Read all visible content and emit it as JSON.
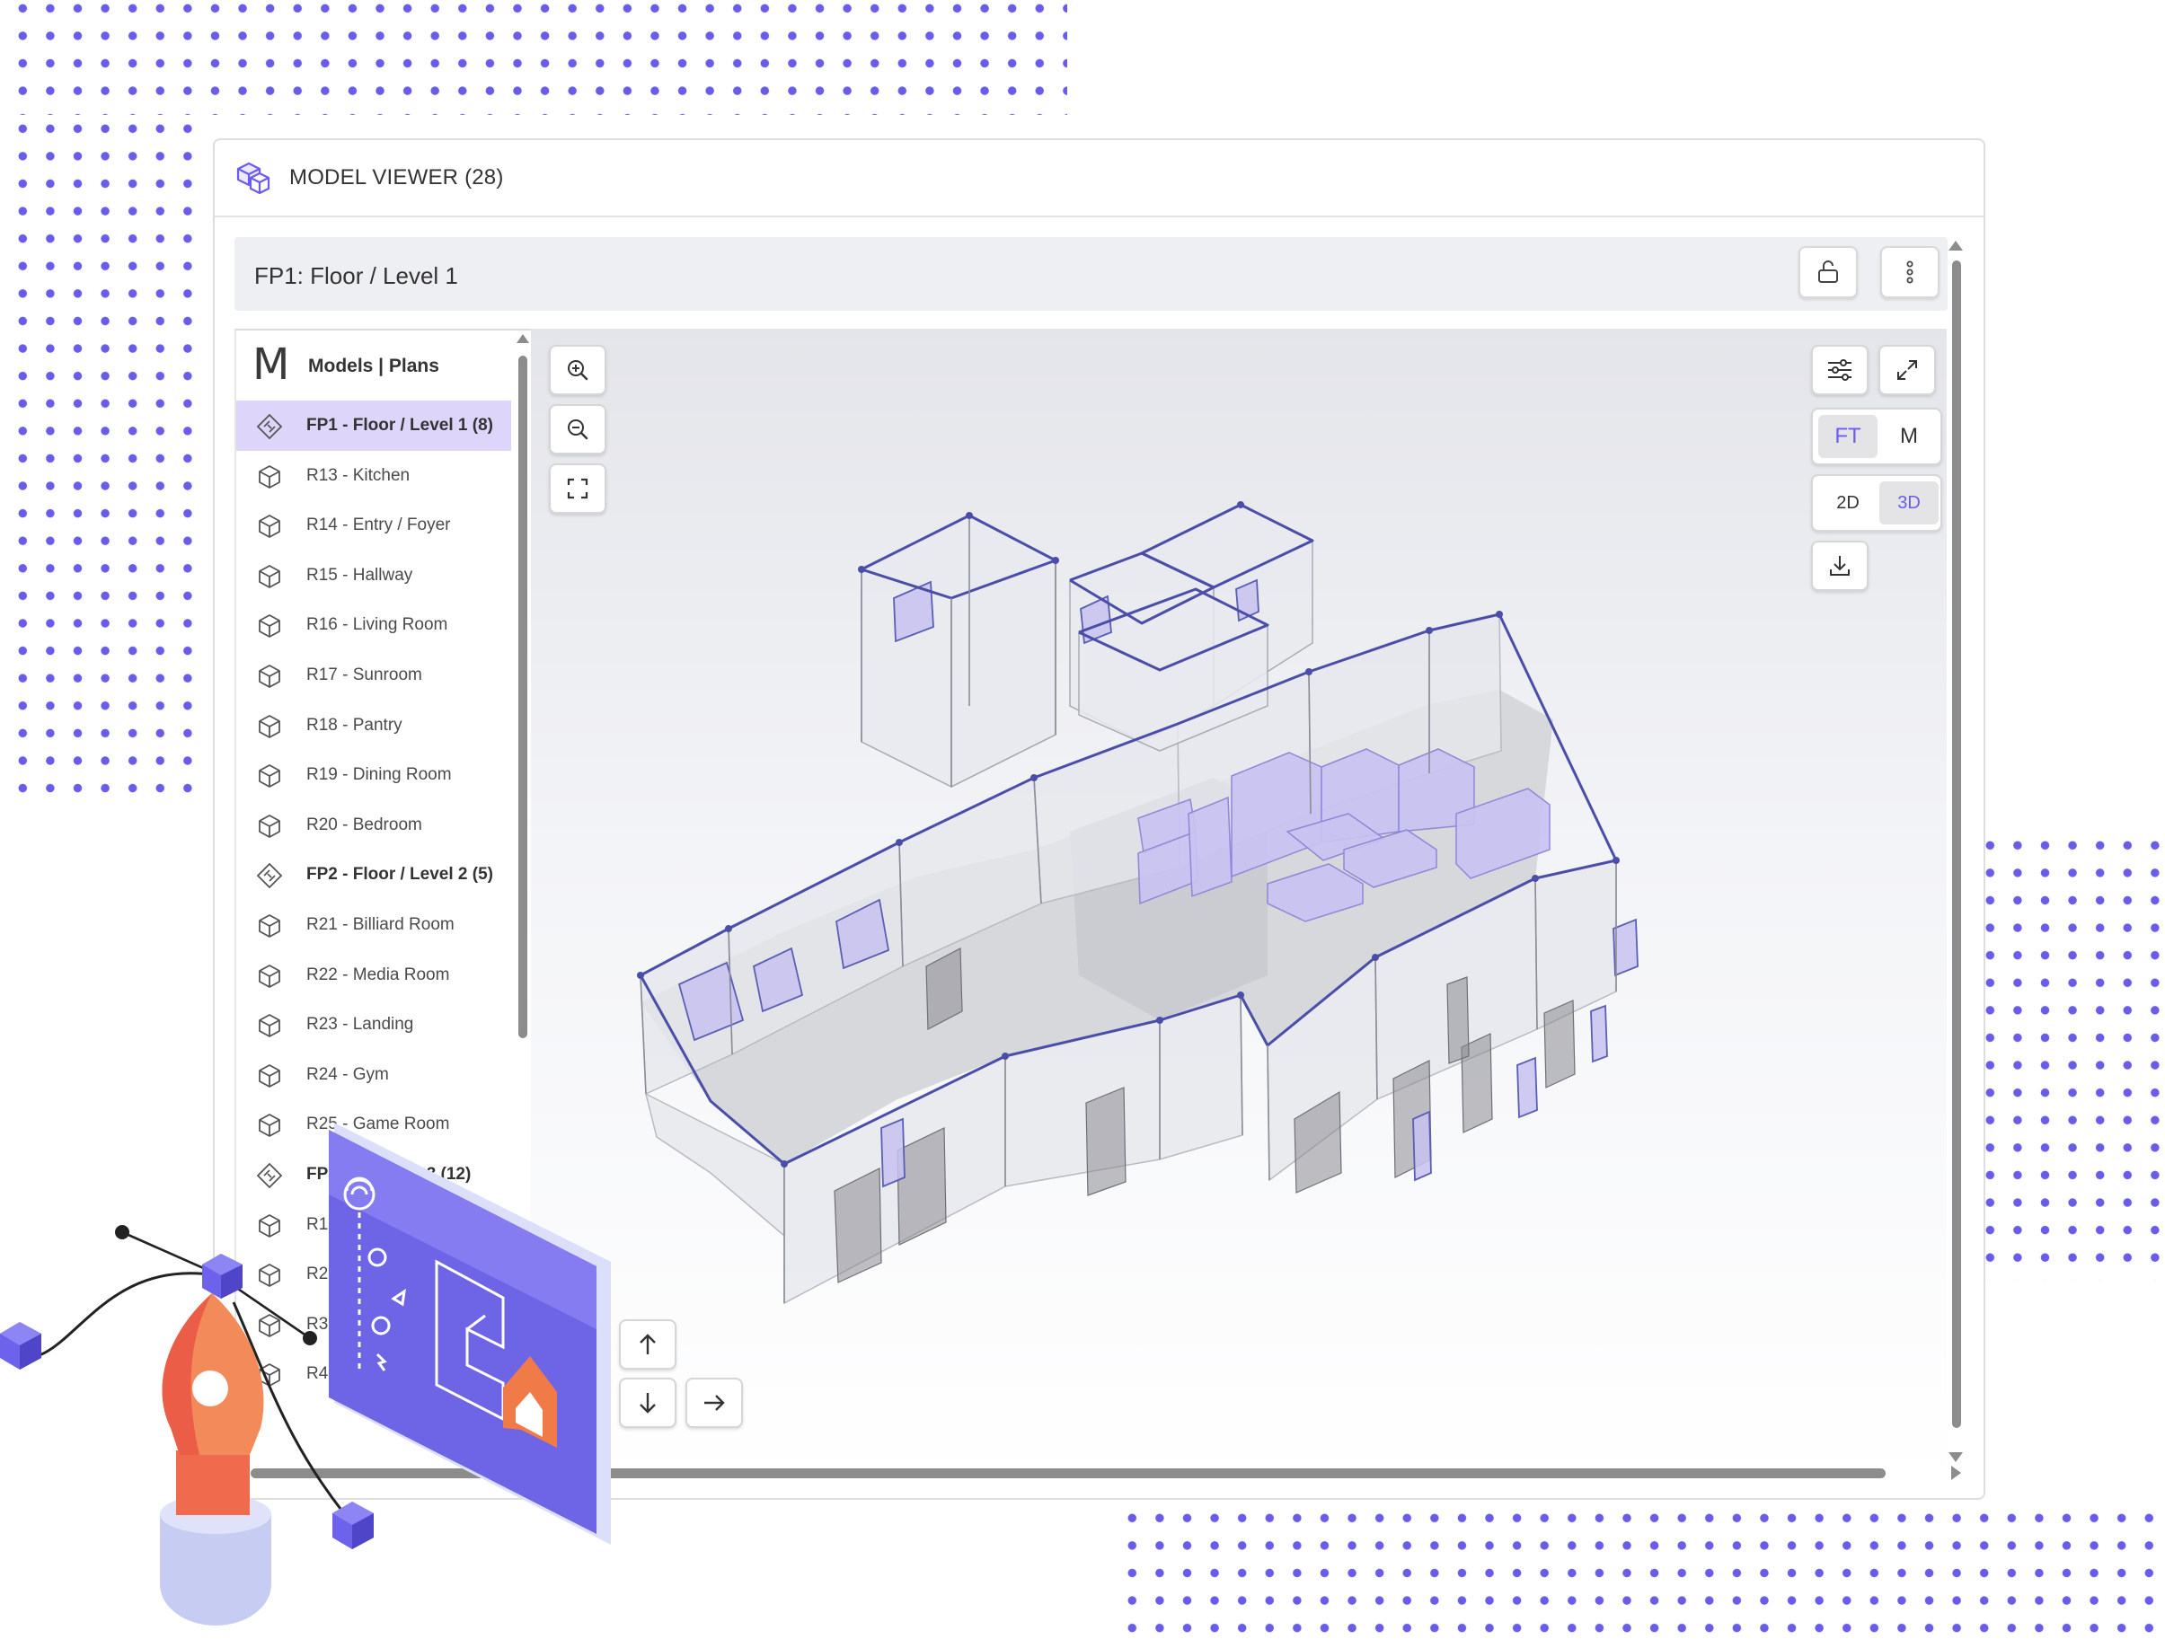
{
  "window": {
    "title": "MODEL VIEWER (28)"
  },
  "plan_bar": {
    "title": "FP1: Floor / Level 1"
  },
  "sidebar": {
    "logo": "M",
    "title": "Models | Plans",
    "items": [
      {
        "label": "FP1 - Floor / Level 1 (8)",
        "kind": "floor",
        "active": true
      },
      {
        "label": "R13 - Kitchen",
        "kind": "room"
      },
      {
        "label": "R14 - Entry / Foyer",
        "kind": "room"
      },
      {
        "label": "R15 - Hallway",
        "kind": "room"
      },
      {
        "label": "R16 - Living Room",
        "kind": "room"
      },
      {
        "label": "R17 - Sunroom",
        "kind": "room"
      },
      {
        "label": "R18 - Pantry",
        "kind": "room"
      },
      {
        "label": "R19 - Dining Room",
        "kind": "room"
      },
      {
        "label": "R20 - Bedroom",
        "kind": "room"
      },
      {
        "label": "FP2 - Floor / Level 2 (5)",
        "kind": "floor"
      },
      {
        "label": "R21 - Billiard Room",
        "kind": "room"
      },
      {
        "label": "R22 - Media Room",
        "kind": "room"
      },
      {
        "label": "R23 - Landing",
        "kind": "room"
      },
      {
        "label": "R24 - Gym",
        "kind": "room"
      },
      {
        "label": "R25 - Game Room",
        "kind": "room"
      },
      {
        "label": "FP3",
        "label_tail": "vel 3 (12)",
        "kind": "floor"
      },
      {
        "label": "R1",
        "kind": "room"
      },
      {
        "label": "R2",
        "kind": "room"
      },
      {
        "label": "R3",
        "kind": "room"
      },
      {
        "label": "R4",
        "kind": "room"
      }
    ]
  },
  "viewer": {
    "units": {
      "ft": "FT",
      "m": "M",
      "selected": "FT"
    },
    "view_mode": {
      "two_d": "2D",
      "three_d": "3D",
      "selected": "3D"
    }
  },
  "colors": {
    "accent": "#6b5cf0",
    "dots": "#6a5ce8",
    "active_row": "#ddd6fa",
    "wall_edge": "#4a4ea8",
    "furniture": "#c9c2f2"
  },
  "icons": [
    "cube-stack-icon",
    "lock-open-icon",
    "more-vertical-icon",
    "zoom-in-icon",
    "zoom-out-icon",
    "fit-screen-icon",
    "sliders-icon",
    "expand-icon",
    "download-icon",
    "arrow-up-icon",
    "arrow-down-icon",
    "arrow-right-icon",
    "floor-plan-icon",
    "cube-icon"
  ]
}
